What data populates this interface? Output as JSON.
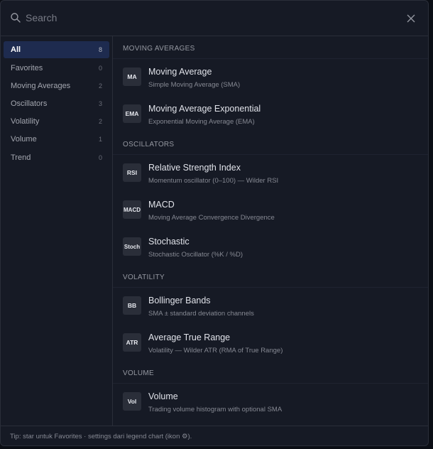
{
  "search": {
    "placeholder": "Search"
  },
  "sidebar": {
    "items": [
      {
        "label": "All",
        "count": "8"
      },
      {
        "label": "Favorites",
        "count": "0"
      },
      {
        "label": "Moving Averages",
        "count": "2"
      },
      {
        "label": "Oscillators",
        "count": "3"
      },
      {
        "label": "Volatility",
        "count": "2"
      },
      {
        "label": "Volume",
        "count": "1"
      },
      {
        "label": "Trend",
        "count": "0"
      }
    ]
  },
  "sections": [
    {
      "title": "MOVING AVERAGES",
      "items": [
        {
          "badge": "MA",
          "name": "Moving Average",
          "desc": "Simple Moving Average (SMA)"
        },
        {
          "badge": "EMA",
          "name": "Moving Average Exponential",
          "desc": "Exponential Moving Average (EMA)"
        }
      ]
    },
    {
      "title": "OSCILLATORS",
      "items": [
        {
          "badge": "RSI",
          "name": "Relative Strength Index",
          "desc": "Momentum oscillator (0–100) — Wilder RSI"
        },
        {
          "badge": "MACD",
          "name": "MACD",
          "desc": "Moving Average Convergence Divergence"
        },
        {
          "badge": "Stoch",
          "name": "Stochastic",
          "desc": "Stochastic Oscillator (%K / %D)"
        }
      ]
    },
    {
      "title": "VOLATILITY",
      "items": [
        {
          "badge": "BB",
          "name": "Bollinger Bands",
          "desc": "SMA ± standard deviation channels"
        },
        {
          "badge": "ATR",
          "name": "Average True Range",
          "desc": "Volatility — Wilder ATR (RMA of True Range)"
        }
      ]
    },
    {
      "title": "VOLUME",
      "items": [
        {
          "badge": "Vol",
          "name": "Volume",
          "desc": "Trading volume histogram with optional SMA"
        }
      ]
    }
  ],
  "footer": {
    "text": "Tip: star untuk Favorites · settings dari legend chart (ikon ⚙)."
  },
  "colors": {
    "active_bg": "#1e2b4f",
    "panel_bg": "#161a25",
    "border": "#2a2e39"
  }
}
